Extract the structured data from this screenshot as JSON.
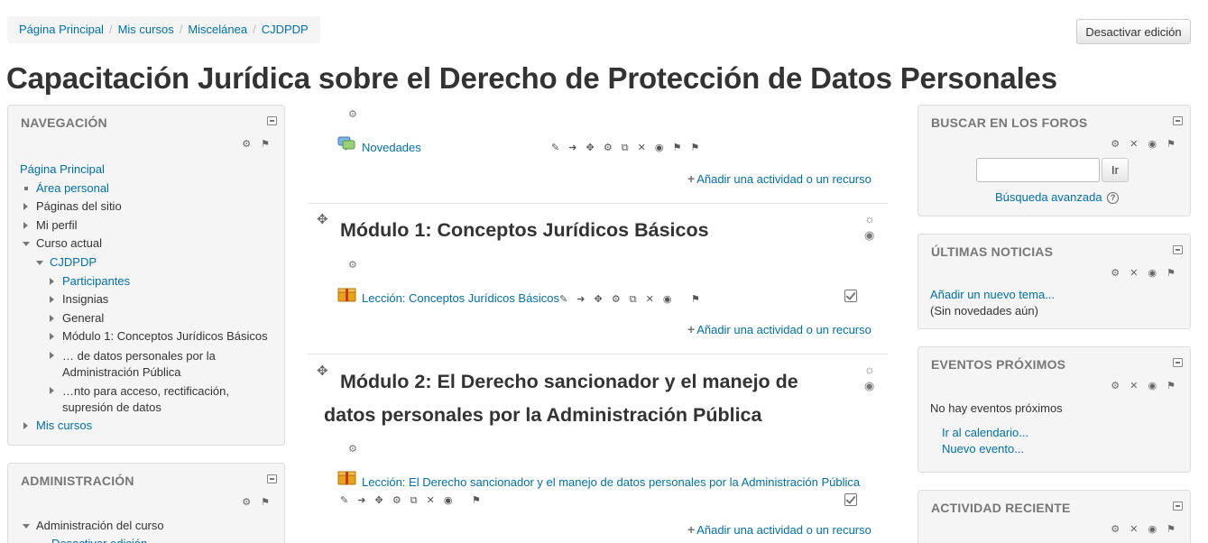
{
  "breadcrumb": [
    "Página Principal",
    "Mis cursos",
    "Miscelánea",
    "CJDPDP"
  ],
  "toolbar": {
    "edit_button": "Desactivar edición"
  },
  "page_title": "Capacitación Jurídica sobre el Derecho de Protección de Datos Personales",
  "navigation": {
    "title": "NAVEGACIÓN",
    "items": [
      "Página Principal",
      "Área personal",
      "Páginas del sitio",
      "Mi perfil",
      "Curso actual",
      "CJDPDP",
      "Participantes",
      "Insignias",
      "General",
      "Módulo 1: Conceptos Jurídicos Básicos",
      "… de datos personales por la Administración Pública",
      "…nto para acceso, rectificación, supresión de datos",
      "Mis cursos"
    ]
  },
  "administration": {
    "title": "ADMINISTRACIÓN",
    "items": [
      "Administración del curso",
      "Desactivar edición"
    ]
  },
  "course": {
    "general": {
      "activity": "Novedades",
      "add_label": "Añadir una actividad o un recurso"
    },
    "sections": [
      {
        "title": "Módulo 1: Conceptos Jurídicos Básicos",
        "activity": "Lección: Conceptos Jurídicos Básicos",
        "add_label": "Añadir una actividad o un recurso"
      },
      {
        "title_line1": "Módulo 2: El Derecho sancionador y el manejo de",
        "title_line2": "datos personales por la Administración Pública",
        "activity": "Lección: El Derecho sancionador y el manejo de datos personales por la Administración Pública",
        "add_label": "Añadir una actividad o un recurso"
      }
    ]
  },
  "forum_search": {
    "title": "BUSCAR EN LOS FOROS",
    "input_value": "",
    "button_label": "Ir",
    "advanced_link": "Búsqueda avanzada"
  },
  "latest_news": {
    "title": "ÚLTIMAS NOTICIAS",
    "add_link": "Añadir un nuevo tema...",
    "empty_text": "(Sin novedades aún)"
  },
  "upcoming_events": {
    "title": "EVENTOS PRÓXIMOS",
    "empty_text": "No hay eventos próximos",
    "calendar_link": "Ir al calendario...",
    "new_event_link": "Nuevo evento..."
  },
  "recent_activity": {
    "title": "ACTIVIDAD RECIENTE"
  },
  "icons": {
    "plus": "+",
    "help": "?",
    "tools_two": "⚙ ⚑",
    "tools_four": "⚙ ✕ ◉ ⚑",
    "activity_edit_full": "✎ ➜ ✥ ⚙ ⧉ ✕ ◉ ⚑ ⚑",
    "activity_edit": "✎ ➜ ✥ ⚙ ⧉ ✕ ◉",
    "group": "⚑"
  },
  "colors": {
    "link": "#0070a8",
    "block_bg": "#f5f5f5",
    "title": "#333333"
  }
}
